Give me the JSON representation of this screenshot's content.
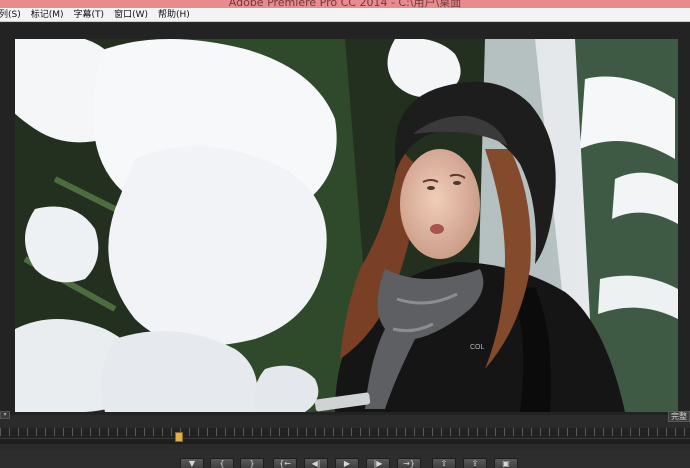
{
  "window": {
    "title": "Adobe Premiere Pro CC 2014 - C:\\用户\\桌面"
  },
  "menubar": {
    "items": [
      {
        "label": "列(S)"
      },
      {
        "label": "标记(M)"
      },
      {
        "label": "字幕(T)"
      },
      {
        "label": "窗口(W)"
      },
      {
        "label": "帮助(H)"
      }
    ]
  },
  "monitor": {
    "fit_value": "完整"
  },
  "transport": {
    "buttons": [
      {
        "name": "add-marker-button",
        "icon": "marker-icon",
        "glyph": "▼"
      },
      {
        "name": "mark-in-button",
        "icon": "mark-in-icon",
        "glyph": "{"
      },
      {
        "name": "mark-out-button",
        "icon": "mark-out-icon",
        "glyph": "}"
      },
      {
        "name": "go-to-in-button",
        "icon": "go-to-in-icon",
        "glyph": "{←"
      },
      {
        "name": "step-back-button",
        "icon": "step-back-icon",
        "glyph": "◀|"
      },
      {
        "name": "play-button",
        "icon": "play-icon",
        "glyph": "▶"
      },
      {
        "name": "step-forward-button",
        "icon": "step-forward-icon",
        "glyph": "|▶"
      },
      {
        "name": "go-to-out-button",
        "icon": "go-to-out-icon",
        "glyph": "→}"
      },
      {
        "name": "lift-button",
        "icon": "lift-icon",
        "glyph": "⇧"
      },
      {
        "name": "extract-button",
        "icon": "extract-icon",
        "glyph": "⇪"
      },
      {
        "name": "export-frame-button",
        "icon": "camera-icon",
        "glyph": "▣"
      }
    ]
  }
}
